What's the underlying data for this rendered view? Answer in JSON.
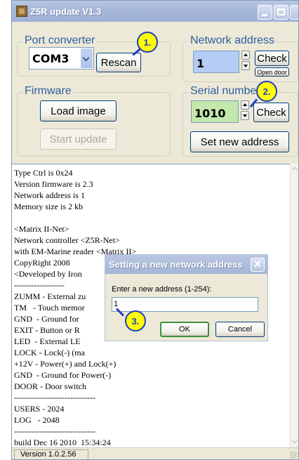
{
  "window": {
    "title": "Z5R update V1.3"
  },
  "port_converter": {
    "label": "Port converter",
    "port_value": "COM3",
    "rescan_label": "Rescan"
  },
  "network_address": {
    "label": "Network address",
    "value": "1",
    "check_label": "Check",
    "open_door_label": "Open door"
  },
  "firmware": {
    "label": "Firmware",
    "load_image_label": "Load image",
    "start_update_label": "Start update"
  },
  "serial_number": {
    "label": "Serial number",
    "value": "1010",
    "check_label": "Check",
    "set_new_address_label": "Set new address"
  },
  "log": {
    "text": "Type Ctrl is 0x24\nVersion firmware is 2.3\nNetwork address is 1\nMemory size is 2 kb\n\n<Matrix II-Net>\nNetwork controller <Z5R-Net>\nwith EM-Marine reader <Matrix II>\nCopyRight 2008\n<Developed by Iron\n------------------\nZUMM - External zu\nTM   - Touch memor\nGND  - Ground for \nEXIT - Button or R\nLED  - External LE\nLOCK - Lock(-) (ma\n+12V - Power(+) and Lock(+)\nGND  - Ground for Power(-)\nDOOR - Door switch\n-----------------------------\nUSERS - 2024\nLOG   - 2048\n-----------------------------\nbuild Dec 16 2010  15:34:24"
  },
  "status": {
    "version": "Version 1.0.2.56"
  },
  "dialog": {
    "title": "Setting a new network address",
    "close_glyph": "✕",
    "prompt": "Enter a new address (1-254):",
    "input_value": "1",
    "ok_label": "OK",
    "cancel_label": "Cancel"
  },
  "callouts": [
    "1.",
    "2.",
    "3."
  ],
  "colors": {
    "accent_blue": "#2e5f9e",
    "field_blue": "#b4cdf5",
    "field_green": "#c4e7ae",
    "callout_yellow": "#fffd00",
    "callout_border": "#1f3fbf"
  }
}
